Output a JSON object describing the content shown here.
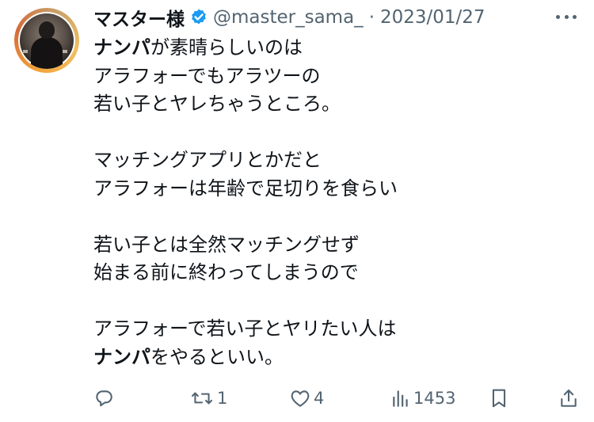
{
  "author": {
    "display_name": "マスター様",
    "handle": "@master_sama_",
    "separator": "·",
    "date": "2023/01/27",
    "verified": true
  },
  "tweet": {
    "lines": [
      {
        "bold": "ナンパ",
        "text": "が素晴らしいのは"
      },
      {
        "bold": "",
        "text": "アラフォーでもアラツーの"
      },
      {
        "bold": "",
        "text": "若い子とヤレちゃうところ。"
      },
      {
        "bold": "",
        "text": ""
      },
      {
        "bold": "",
        "text": "マッチングアプリとかだと"
      },
      {
        "bold": "",
        "text": "アラフォーは年齢で足切りを食らい"
      },
      {
        "bold": "",
        "text": ""
      },
      {
        "bold": "",
        "text": "若い子とは全然マッチングせず"
      },
      {
        "bold": "",
        "text": "始まる前に終わってしまうので"
      },
      {
        "bold": "",
        "text": ""
      },
      {
        "bold": "",
        "text": "アラフォーで若い子とヤリたい人は"
      },
      {
        "bold": "ナンパ",
        "text": "をやるといい。"
      }
    ]
  },
  "actions": {
    "reply": {
      "icon": "reply-icon",
      "count": ""
    },
    "retweet": {
      "icon": "retweet-icon",
      "count": "1"
    },
    "like": {
      "icon": "heart-icon",
      "count": "4"
    },
    "views": {
      "icon": "views-icon",
      "count": "1453"
    },
    "bookmark": {
      "icon": "bookmark-icon",
      "count": ""
    },
    "share": {
      "icon": "share-icon",
      "count": ""
    }
  },
  "colors": {
    "text": "#0f1419",
    "secondary": "#536471",
    "verified": "#1d9bf0"
  }
}
